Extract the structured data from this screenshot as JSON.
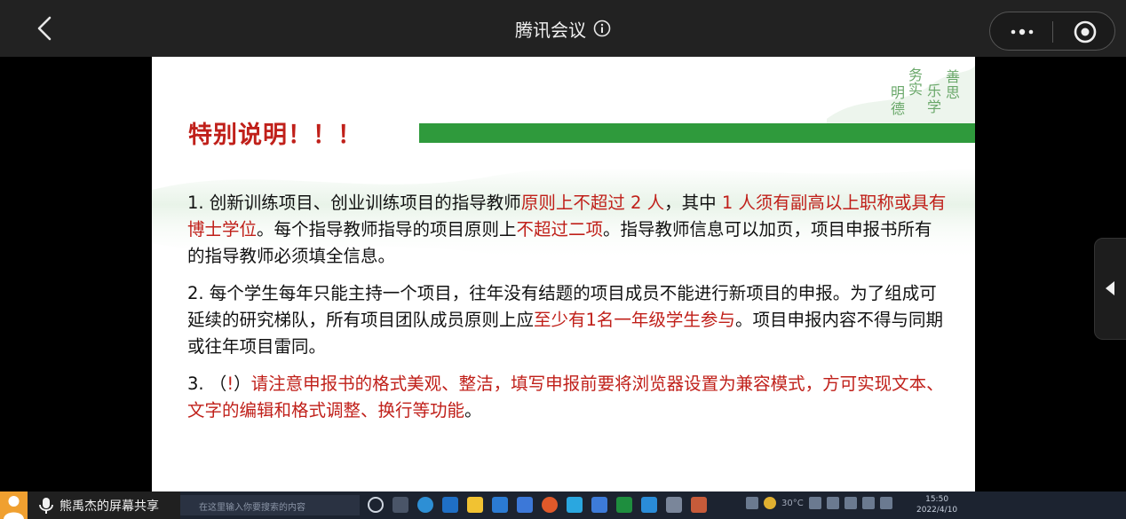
{
  "app": {
    "title": "腾讯会议"
  },
  "slide": {
    "motto": [
      "务",
      "实",
      "善",
      "思",
      "明",
      "德",
      "乐",
      "学"
    ],
    "heading": "特别说明！！！",
    "items": [
      {
        "segments": [
          {
            "text": "1.   创新训练项目、创业训练项目的指导教师",
            "hl": false
          },
          {
            "text": "原则上不超过 2 人",
            "hl": true
          },
          {
            "text": "，其中 ",
            "hl": false
          },
          {
            "text": "1 人须有副高以上职称或具有博士学位",
            "hl": true
          },
          {
            "text": "。每个指导教师指导的项目原则上",
            "hl": false
          },
          {
            "text": "不超过二项",
            "hl": true
          },
          {
            "text": "。指导教师信息可以加页，项目申报书所有的指导教师必须填全信息。",
            "hl": false
          }
        ]
      },
      {
        "segments": [
          {
            "text": "2.   每个学生每年只能主持一个项目，往年没有结题的项目成员不能进行新项目的申报。为了组成可延续的研究梯队，所有项目团队成员原则上应",
            "hl": false
          },
          {
            "text": "至少有1名一年级学生参与",
            "hl": true
          },
          {
            "text": "。项目申报内容不得与同期或往年项目雷同。",
            "hl": false
          }
        ]
      },
      {
        "segments": [
          {
            "text": "3.   （",
            "hl": false
          },
          {
            "text": "!",
            "hl": true
          },
          {
            "text": "）",
            "hl": false
          },
          {
            "text": "请注意申报书的格式美观、整洁，填写申报前要将浏览器设置为兼容模式，方可实现文本、文字的编辑和格式调整、换行等功能",
            "hl": true
          },
          {
            "text": "。",
            "hl": false
          }
        ]
      }
    ]
  },
  "taskbar": {
    "search_placeholder": "在这里输入你要搜索的内容",
    "temperature": "30°C",
    "time": "15:50",
    "date": "2022/4/10"
  },
  "share": {
    "label": "熊禹杰的屏幕共享"
  },
  "colors": {
    "accent_red": "#c0201a",
    "accent_green": "#2f9a3c"
  }
}
